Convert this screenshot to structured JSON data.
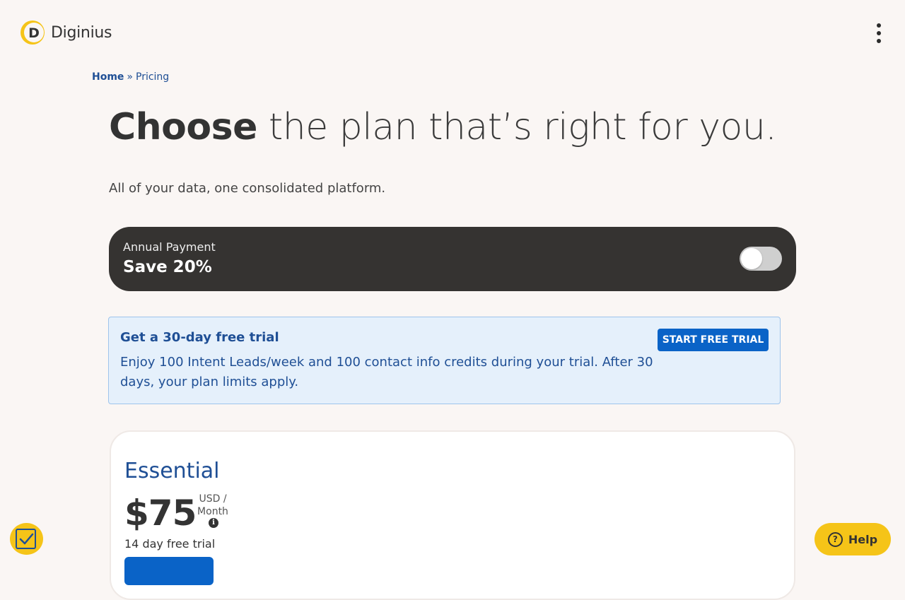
{
  "header": {
    "brand": "Diginius",
    "logo_letter": "D"
  },
  "breadcrumb": {
    "home": "Home",
    "separator": "»",
    "current": "Pricing"
  },
  "hero": {
    "title_bold": "Choose",
    "title_rest": " the plan that’s right for you.",
    "subtitle": "All of your data, one consolidated platform."
  },
  "annual_toggle": {
    "label": "Annual Payment",
    "save": "Save 20%",
    "enabled": false
  },
  "trial_banner": {
    "title": "Get a 30-day free trial",
    "body": "Enjoy 100 Intent Leads/week and 100 contact info credits during your trial. After 30 days, your plan limits apply.",
    "button": "START FREE TRIAL"
  },
  "plans": [
    {
      "name": "Essential",
      "price": "$75",
      "unit_line1": "USD /",
      "unit_line2": "Month",
      "trial": "14 day free trial"
    }
  ],
  "help": {
    "label": "Help",
    "glyph": "?"
  },
  "colors": {
    "background": "#faf6f4",
    "brand_blue": "#1f4f95",
    "button_blue": "#0a63c7",
    "accent_yellow": "#f5c418",
    "dark_panel": "#353331"
  },
  "icons": {
    "menu": "more-vertical-icon",
    "info": "info-icon",
    "help": "question-circle-icon",
    "badge": "check-badge-icon"
  }
}
